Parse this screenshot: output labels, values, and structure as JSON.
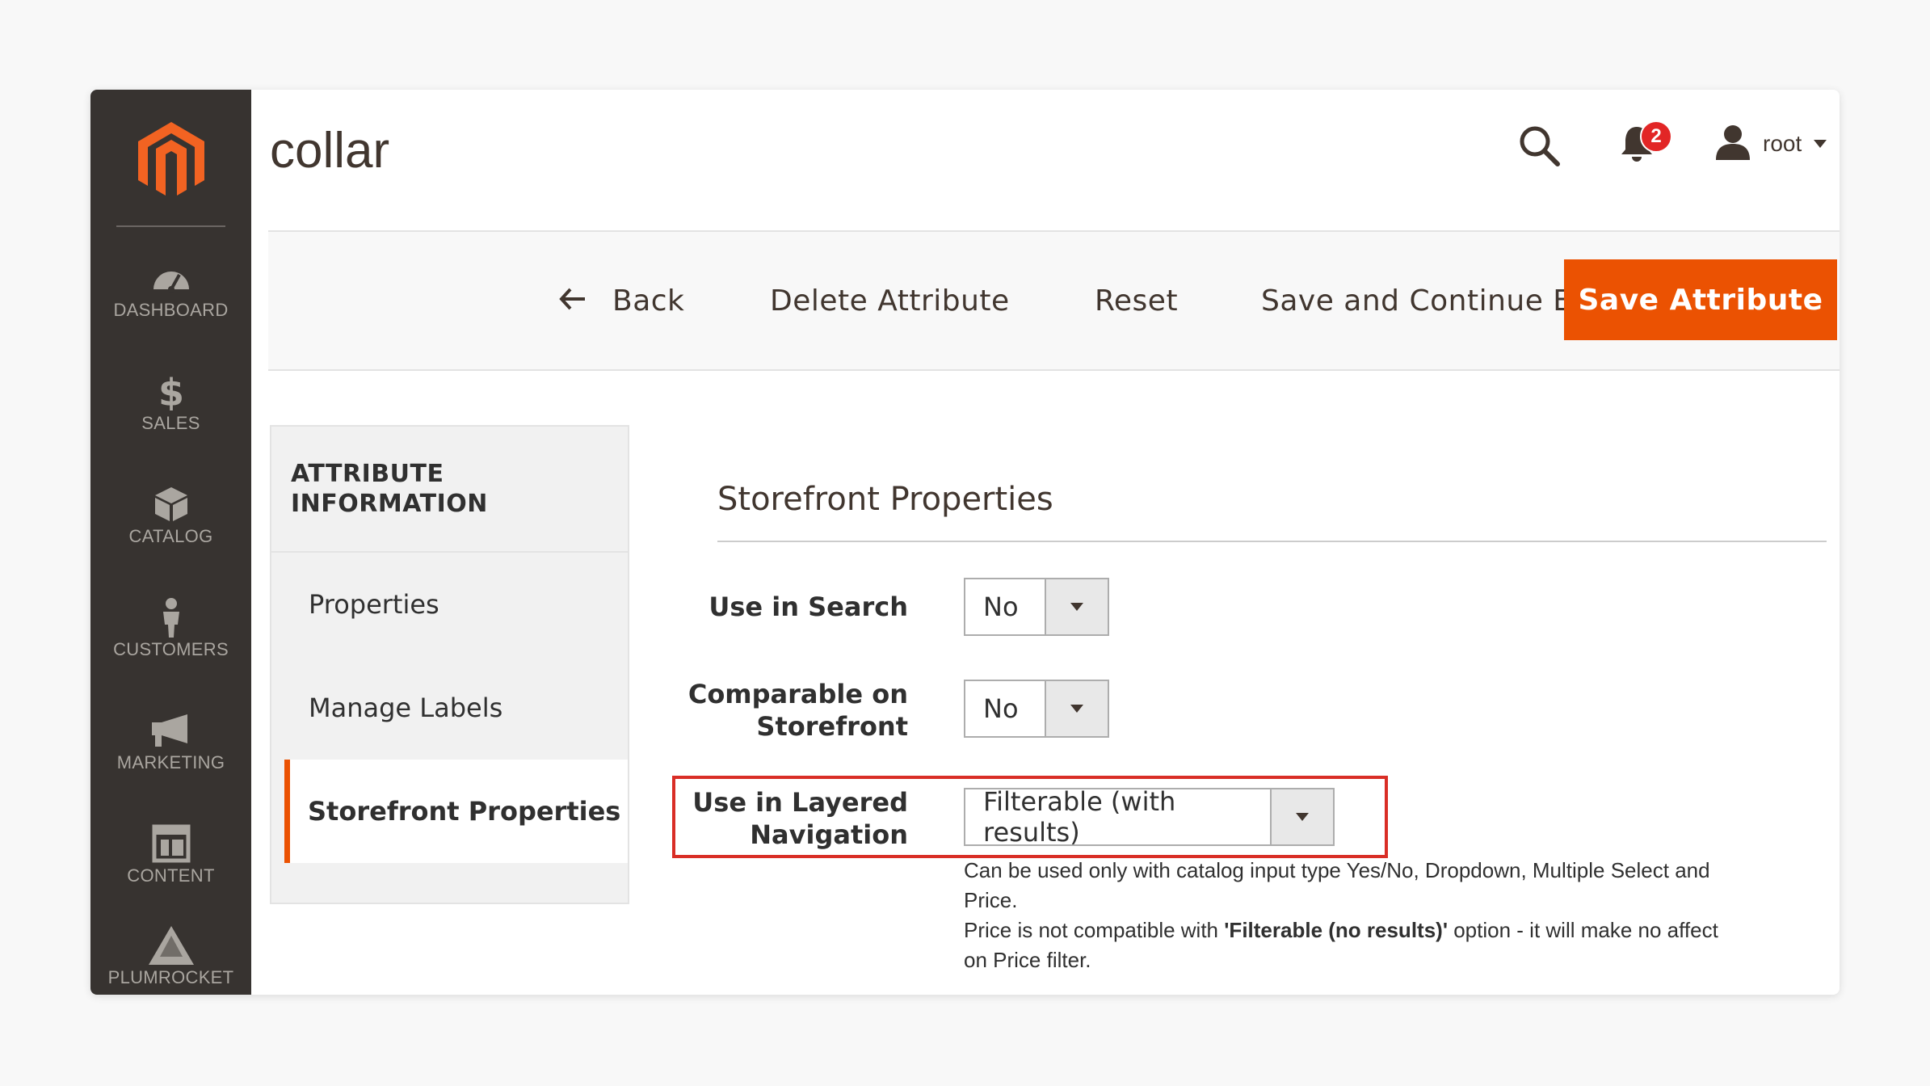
{
  "sidebar": {
    "items": [
      {
        "label": "DASHBOARD",
        "icon": "dashboard-gauge-icon"
      },
      {
        "label": "SALES",
        "icon": "dollar-icon"
      },
      {
        "label": "CATALOG",
        "icon": "box-icon"
      },
      {
        "label": "CUSTOMERS",
        "icon": "person-icon"
      },
      {
        "label": "MARKETING",
        "icon": "megaphone-icon"
      },
      {
        "label": "CONTENT",
        "icon": "layout-icon"
      },
      {
        "label": "PLUMROCKET",
        "icon": "plumrocket-icon"
      }
    ]
  },
  "header": {
    "title": "collar",
    "notification_count": "2",
    "user_name": "root"
  },
  "actions": {
    "back": "Back",
    "delete": "Delete Attribute",
    "reset": "Reset",
    "save_continue": "Save and Continue Edit",
    "save": "Save Attribute"
  },
  "tabs": {
    "heading_line1": "ATTRIBUTE",
    "heading_line2": "INFORMATION",
    "items": [
      {
        "label": "Properties"
      },
      {
        "label": "Manage Labels"
      },
      {
        "label": "Storefront Properties"
      }
    ]
  },
  "form": {
    "section_title": "Storefront Properties",
    "fields": [
      {
        "label_line1": "Use in Search",
        "label_line2": "",
        "value": "No"
      },
      {
        "label_line1": "Comparable on",
        "label_line2": "Storefront",
        "value": "No"
      },
      {
        "label_line1": "Use in Layered",
        "label_line2": "Navigation",
        "value": "Filterable (with results)"
      }
    ],
    "note_line1": "Can be used only with catalog input type Yes/No, Dropdown, Multiple Select and Price.",
    "note_line2_pre": "Price is not compatible with ",
    "note_line2_bold": "'Filterable (no results)'",
    "note_line2_post": " option - it will make no affect on Price filter."
  },
  "colors": {
    "accent": "#eb5202",
    "sidebar_bg": "#373330",
    "highlight": "#d92e26"
  }
}
